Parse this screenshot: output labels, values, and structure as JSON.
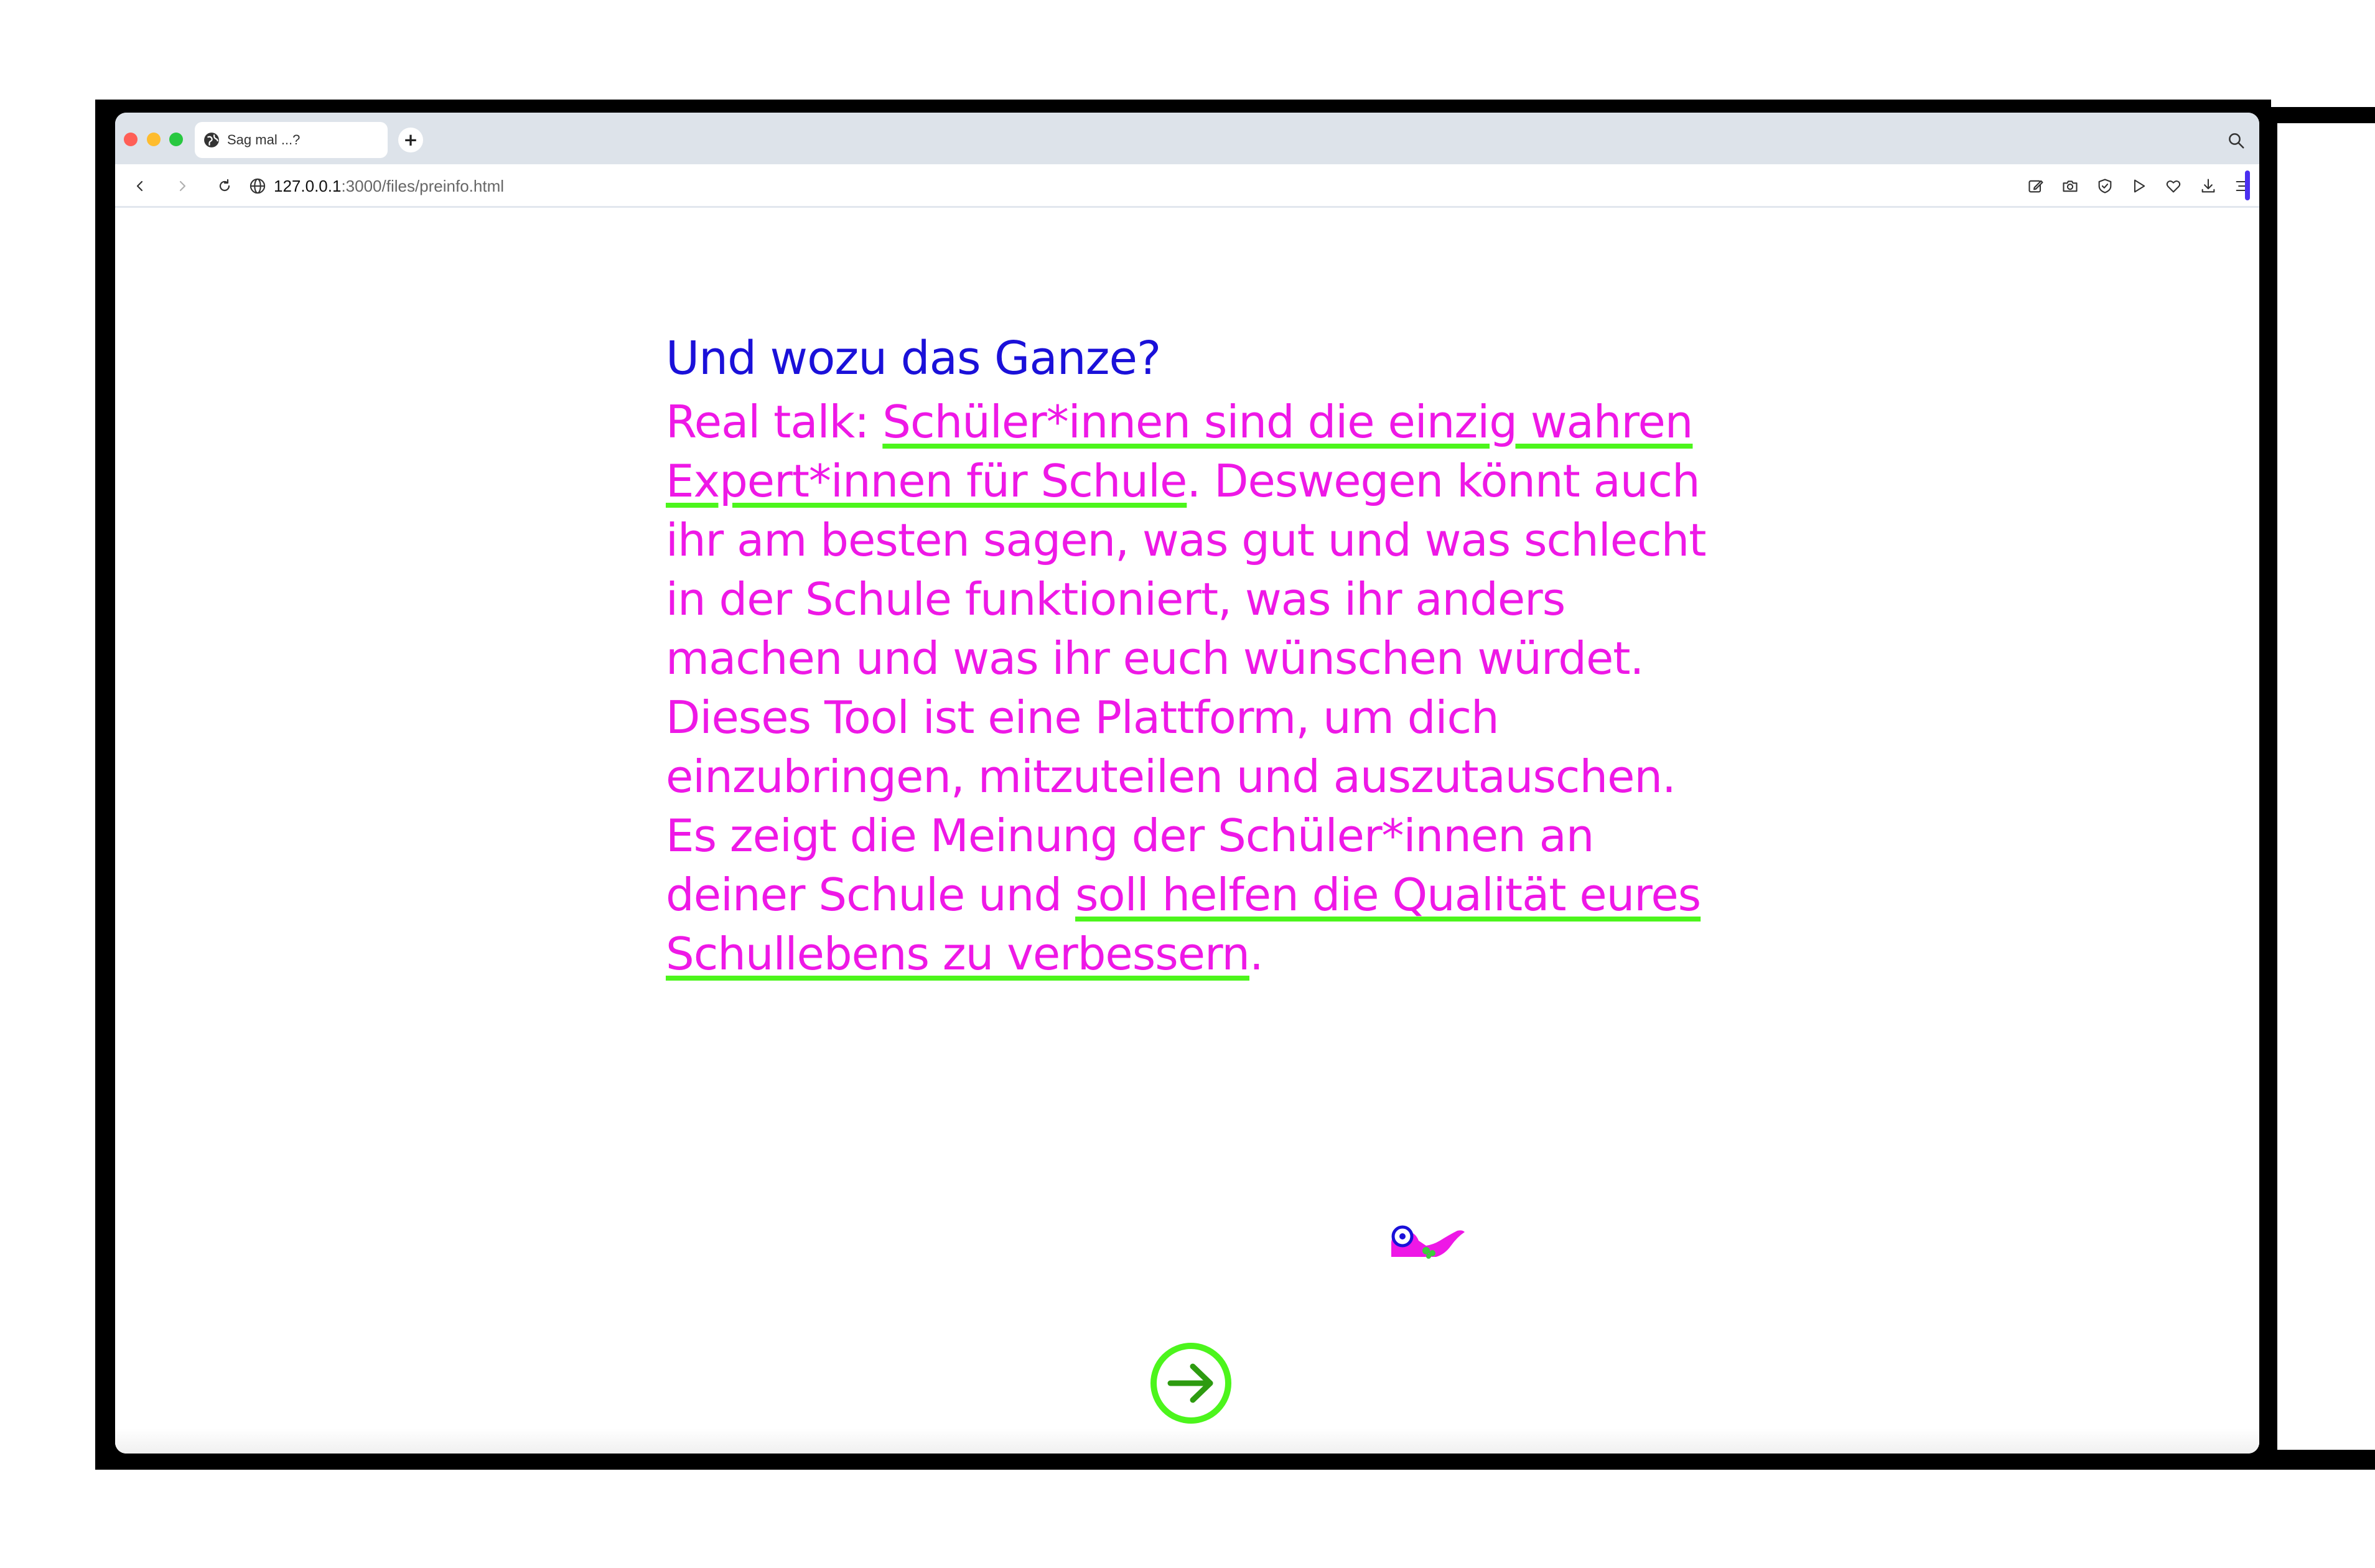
{
  "browser": {
    "tab": {
      "title": "Sag mal ...?"
    },
    "url": {
      "host": "127.0.0.1",
      "rest": ":3000/files/preinfo.html"
    }
  },
  "page": {
    "heading": "Und wozu das Ganze?",
    "paragraph": {
      "intro": "Real talk: ",
      "highlight1": "Schüler*innen sind die einzig wahren Expert*innen für Schule",
      "middle": ". Deswegen könnt auch ihr am besten sagen, was gut und was schlecht in der Schule funktioniert, was ihr anders machen und was ihr euch wünschen würdet. Dieses Tool ist eine Plattform, um dich einzubringen, mitzuteilen und auszutauschen. Es zeigt die Meinung der Schüler*innen an deiner Schule und ",
      "highlight2": "soll helfen die Qualität eures Schullebens zu verbessern",
      "end": "."
    }
  },
  "colors": {
    "heading": "#1a10d9",
    "body": "#ee18e6",
    "highlight": "#4cf51c",
    "next_button": "#4cf51c",
    "profile": "#5b3cf5"
  },
  "icons": [
    "back-icon",
    "forward-icon",
    "reload-icon",
    "globe-icon",
    "edit-icon",
    "camera-icon",
    "shield-icon",
    "play-icon",
    "heart-icon",
    "download-icon",
    "menu-icon",
    "profile-icon",
    "cube-icon",
    "search-icon",
    "arrow-right-circle-icon",
    "mascot-icon"
  ]
}
